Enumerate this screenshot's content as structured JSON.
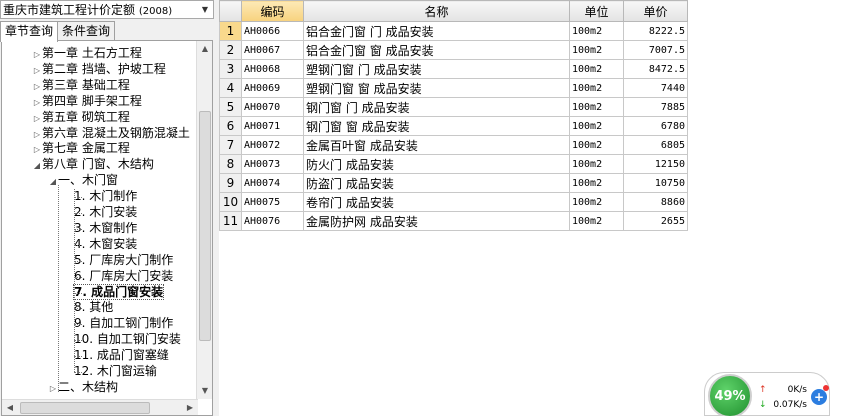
{
  "dropdown": {
    "value": "重庆市建筑工程计价定额",
    "version": "(2008)"
  },
  "tabs": [
    "章节查询",
    "条件查询"
  ],
  "tree": [
    {
      "label": "第一章  土石方工程",
      "exp": "▷"
    },
    {
      "label": "第二章  挡墙、护坡工程",
      "exp": "▷"
    },
    {
      "label": "第三章  基础工程",
      "exp": "▷"
    },
    {
      "label": "第四章  脚手架工程",
      "exp": "▷"
    },
    {
      "label": "第五章  砌筑工程",
      "exp": "▷"
    },
    {
      "label": "第六章  混凝土及钢筋混凝土",
      "exp": "▷"
    },
    {
      "label": "第七章  金属工程",
      "exp": "▷"
    },
    {
      "label": "第八章  门窗、木结构",
      "exp": "◢"
    },
    {
      "label": "一、木门窗",
      "exp": "◢"
    },
    {
      "label": "1. 木门制作",
      "exp": ""
    },
    {
      "label": "2. 木门安装",
      "exp": ""
    },
    {
      "label": "3. 木窗制作",
      "exp": ""
    },
    {
      "label": "4. 木窗安装",
      "exp": ""
    },
    {
      "label": "5. 厂库房大门制作",
      "exp": ""
    },
    {
      "label": "6. 厂库房大门安装",
      "exp": ""
    },
    {
      "label": "7. 成品门窗安装",
      "exp": ""
    },
    {
      "label": "8. 其他",
      "exp": ""
    },
    {
      "label": "9. 自加工钢门制作",
      "exp": ""
    },
    {
      "label": "10. 自加工钢门安装",
      "exp": ""
    },
    {
      "label": "11. 成品门窗塞缝",
      "exp": ""
    },
    {
      "label": "12. 木门窗运输",
      "exp": ""
    },
    {
      "label": "二、木结构",
      "exp": "▷"
    }
  ],
  "grid": {
    "headers": [
      "",
      "编码",
      "名称",
      "单位",
      "单价"
    ],
    "rows": [
      {
        "n": "1",
        "code": "AH0066",
        "name": "铝合金门窗 门 成品安装",
        "unit": "100m2",
        "price": "8222.5"
      },
      {
        "n": "2",
        "code": "AH0067",
        "name": "铝合金门窗 窗 成品安装",
        "unit": "100m2",
        "price": "7007.5"
      },
      {
        "n": "3",
        "code": "AH0068",
        "name": "塑钢门窗 门 成品安装",
        "unit": "100m2",
        "price": "8472.5"
      },
      {
        "n": "4",
        "code": "AH0069",
        "name": "塑钢门窗 窗 成品安装",
        "unit": "100m2",
        "price": "7440"
      },
      {
        "n": "5",
        "code": "AH0070",
        "name": "钢门窗 门 成品安装",
        "unit": "100m2",
        "price": "7885"
      },
      {
        "n": "6",
        "code": "AH0071",
        "name": "钢门窗 窗 成品安装",
        "unit": "100m2",
        "price": "6780"
      },
      {
        "n": "7",
        "code": "AH0072",
        "name": "金属百叶窗 成品安装",
        "unit": "100m2",
        "price": "6805"
      },
      {
        "n": "8",
        "code": "AH0073",
        "name": "防火门 成品安装",
        "unit": "100m2",
        "price": "12150"
      },
      {
        "n": "9",
        "code": "AH0074",
        "name": "防盗门 成品安装",
        "unit": "100m2",
        "price": "10750"
      },
      {
        "n": "10",
        "code": "AH0075",
        "name": "卷帘门 成品安装",
        "unit": "100m2",
        "price": "8860"
      },
      {
        "n": "11",
        "code": "AH0076",
        "name": "金属防护网 成品安装",
        "unit": "100m2",
        "price": "2655"
      }
    ]
  },
  "speed": {
    "percent": "49%",
    "up": "0K/s",
    "down": "0.07K/s"
  }
}
